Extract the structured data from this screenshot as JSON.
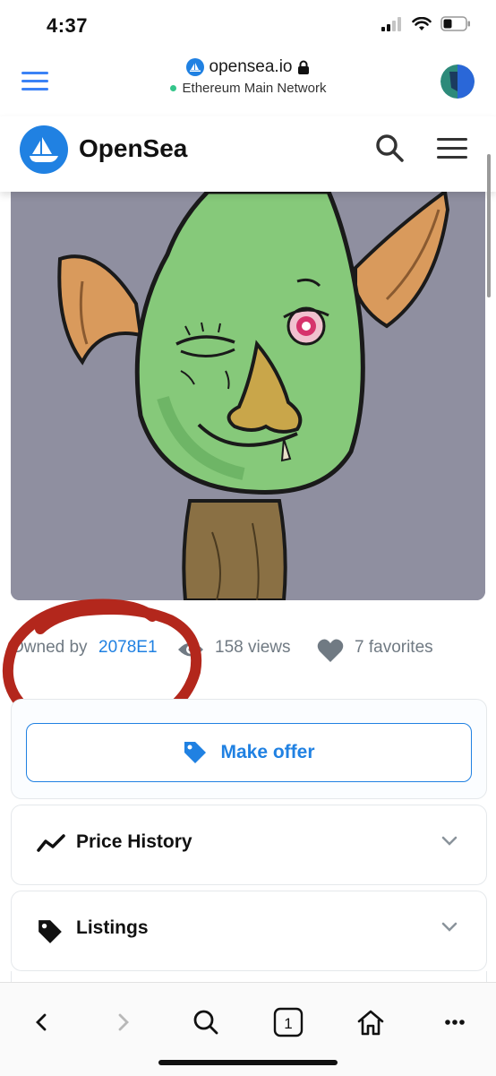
{
  "status_bar": {
    "time": "4:37"
  },
  "browser": {
    "domain": "opensea.io",
    "network": "Ethereum Main Network"
  },
  "header": {
    "brand": "OpenSea"
  },
  "asset": {
    "owner_prefix": "Owned by",
    "owner": "2078E1",
    "views": "158 views",
    "favorites": "7 favorites"
  },
  "actions": {
    "make_offer": "Make offer"
  },
  "sections": {
    "price_history": "Price History",
    "listings": "Listings"
  },
  "toolbar": {
    "tab_count": "1"
  },
  "colors": {
    "brand_blue": "#2081e2",
    "annotation_red": "#b3271c",
    "image_bg": "#8f8fa0"
  },
  "icons": [
    "hamburger-icon",
    "lock-icon",
    "search-icon",
    "menu-icon",
    "eye-icon",
    "heart-icon",
    "tag-icon",
    "trend-icon",
    "chevron-down-icon",
    "back-icon",
    "forward-icon",
    "tabs-icon",
    "home-icon",
    "more-icon"
  ]
}
